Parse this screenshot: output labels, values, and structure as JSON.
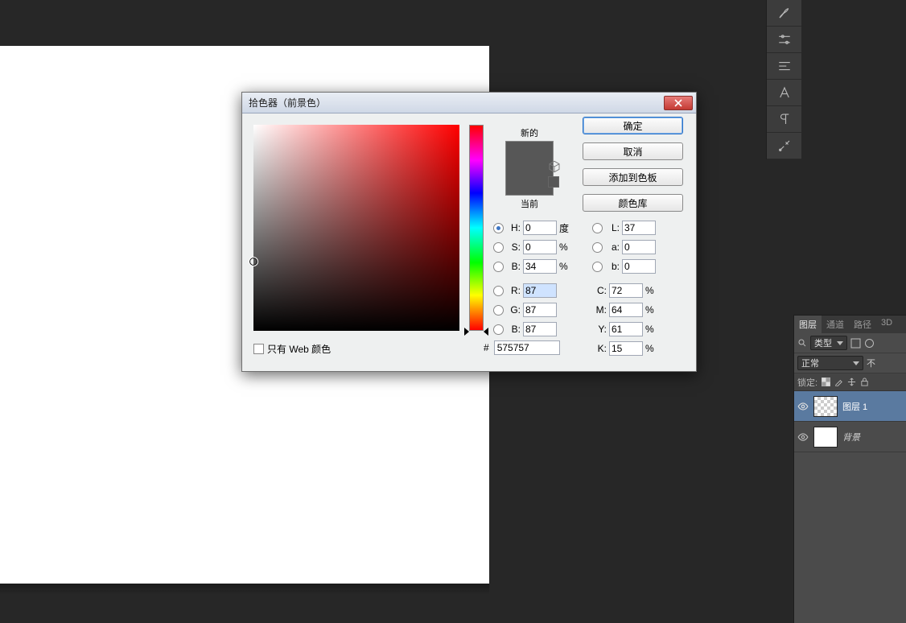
{
  "dialog": {
    "title": "拾色器（前景色）",
    "new_label": "新的",
    "current_label": "当前",
    "buttons": {
      "ok": "确定",
      "cancel": "取消",
      "add": "添加到色板",
      "libraries": "颜色库"
    },
    "fields": {
      "H": {
        "label": "H:",
        "value": "0",
        "unit": "度"
      },
      "S": {
        "label": "S:",
        "value": "0",
        "unit": "%"
      },
      "Bb": {
        "label": "B:",
        "value": "34",
        "unit": "%"
      },
      "R": {
        "label": "R:",
        "value": "87"
      },
      "G": {
        "label": "G:",
        "value": "87"
      },
      "Bv": {
        "label": "B:",
        "value": "87"
      },
      "L": {
        "label": "L:",
        "value": "37"
      },
      "a": {
        "label": "a:",
        "value": "0"
      },
      "b": {
        "label": "b:",
        "value": "0"
      },
      "C": {
        "label": "C:",
        "value": "72",
        "unit": "%"
      },
      "M": {
        "label": "M:",
        "value": "64",
        "unit": "%"
      },
      "Y": {
        "label": "Y:",
        "value": "61",
        "unit": "%"
      },
      "K": {
        "label": "K:",
        "value": "15",
        "unit": "%"
      }
    },
    "hex_label": "#",
    "hex": "575757",
    "web_only": "只有 Web 颜色",
    "selected_radio": "H",
    "color_preview": "#575757"
  },
  "panel": {
    "tabs": [
      "图层",
      "通道",
      "路径",
      "3D"
    ],
    "active_tab": 0,
    "type_label": "类型",
    "blend_mode": "正常",
    "opacity_label": "不",
    "lock_label": "锁定:",
    "layers": [
      {
        "name": "图层 1",
        "active": true,
        "checker": true
      },
      {
        "name": "背景",
        "active": false,
        "checker": false,
        "italic": true
      }
    ]
  },
  "right_toolbar_icons": [
    "brush-panel-icon",
    "sliders-icon",
    "align-icon",
    "type-a-icon",
    "paragraph-icon",
    "tools-icon"
  ]
}
